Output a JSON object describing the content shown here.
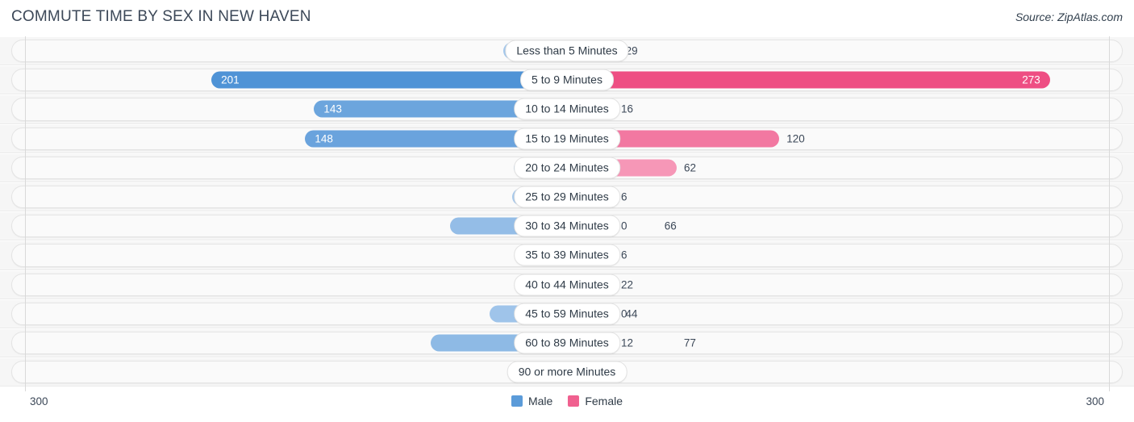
{
  "header": {
    "title": "COMMUTE TIME BY SEX IN NEW HAVEN",
    "source": "Source: ZipAtlas.com"
  },
  "footer": {
    "axis_left": "300",
    "axis_right": "300"
  },
  "legend": [
    {
      "label": "Male",
      "color": "#5b9bd9"
    },
    {
      "label": "Female",
      "color": "#f0608f"
    }
  ],
  "chart_data": {
    "type": "bar",
    "subtype": "diverging-horizontal",
    "title": "COMMUTE TIME BY SEX IN NEW HAVEN",
    "xlabel": "",
    "ylabel": "",
    "xlim": [
      300,
      300
    ],
    "axis_max": 300,
    "grid": false,
    "legend_position": "bottom-center",
    "categories": [
      "Less than 5 Minutes",
      "5 to 9 Minutes",
      "10 to 14 Minutes",
      "15 to 19 Minutes",
      "20 to 24 Minutes",
      "25 to 29 Minutes",
      "30 to 34 Minutes",
      "35 to 39 Minutes",
      "40 to 44 Minutes",
      "45 to 59 Minutes",
      "60 to 89 Minutes",
      "90 or more Minutes"
    ],
    "series": [
      {
        "name": "Male",
        "direction": "left",
        "color": "#5b9bd9",
        "values": [
          36,
          201,
          143,
          148,
          30,
          31,
          66,
          0,
          4,
          44,
          77,
          0
        ]
      },
      {
        "name": "Female",
        "direction": "right",
        "color": "#f0608f",
        "values": [
          29,
          273,
          16,
          120,
          62,
          6,
          0,
          6,
          22,
          0,
          12,
          0
        ]
      }
    ]
  }
}
